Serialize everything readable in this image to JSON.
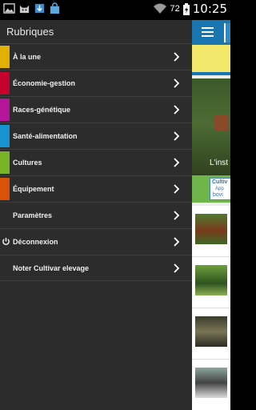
{
  "status_bar": {
    "icons_left": [
      "gallery-icon",
      "cat-icon",
      "download-icon",
      "store-icon"
    ],
    "battery_level": "72",
    "time": "10:25"
  },
  "drawer": {
    "title": "Rubriques",
    "items": [
      {
        "label": "À la une",
        "color": "#e1b000"
      },
      {
        "label": "Économie-gestion",
        "color": "#c8002e"
      },
      {
        "label": "Races-génétique",
        "color": "#b5159b"
      },
      {
        "label": "Santé-alimentation",
        "color": "#1694d2"
      },
      {
        "label": "Cultures",
        "color": "#7bb327"
      },
      {
        "label": "Équipement",
        "color": "#d9520a"
      }
    ],
    "settings": [
      {
        "label": "Paramètres",
        "icon": ""
      },
      {
        "label": "Déconnexion",
        "icon": "power-icon"
      },
      {
        "label": "Noter Cultivar elevage",
        "icon": ""
      }
    ]
  },
  "background_app": {
    "hero_caption": "L'inst",
    "ad_line1": "Cultiv",
    "ad_line2": "App",
    "ad_line3": "bovi"
  }
}
